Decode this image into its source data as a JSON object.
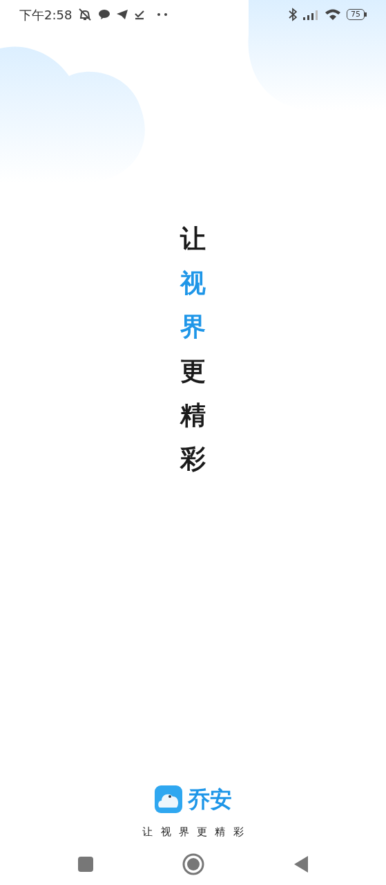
{
  "status_bar": {
    "time": "下午2:58",
    "battery": "75"
  },
  "slogan": [
    {
      "text": "让",
      "color": "#1a1a1a"
    },
    {
      "text": "视界",
      "color": "#1e96e8"
    },
    {
      "text": "更精彩",
      "color": "#1a1a1a"
    }
  ],
  "brand": {
    "name": "乔安",
    "tagline": "让视界更精彩"
  }
}
